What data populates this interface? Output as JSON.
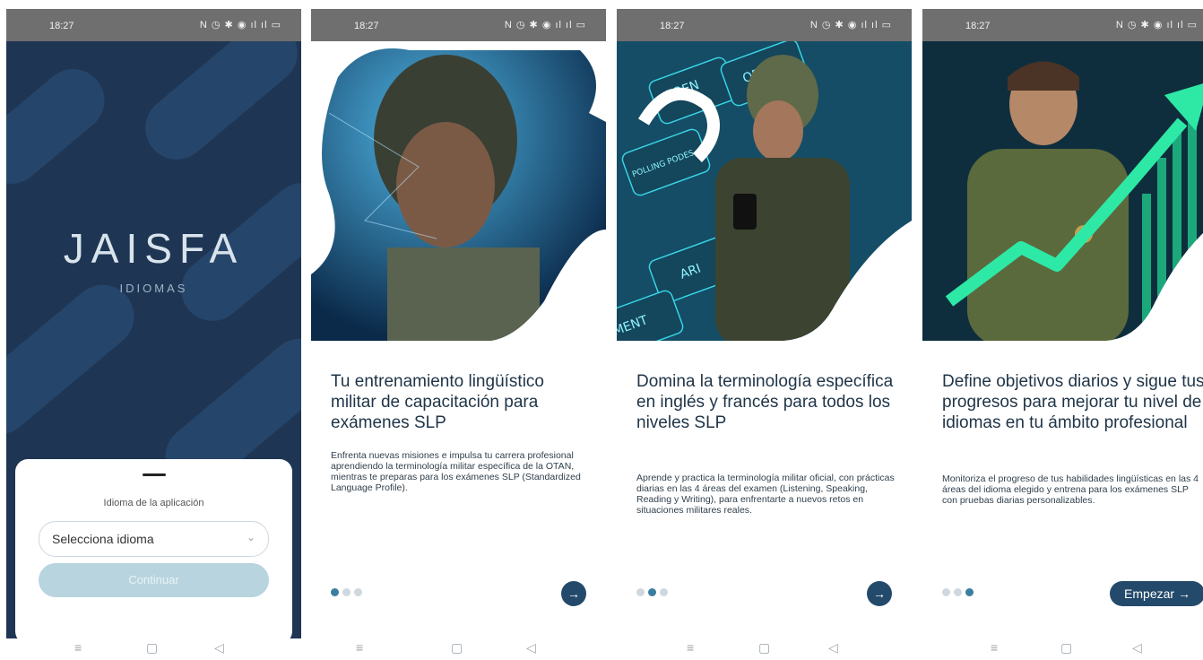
{
  "status": {
    "time": "18:27",
    "icons": "N ◷ ✱ ◉ ıl ıl ▭"
  },
  "nav": {
    "menu": "≡",
    "home": "▢",
    "back": "◁"
  },
  "splash": {
    "logo": "JAISFA",
    "subtitle": "IDIOMAS",
    "language_label": "Idioma de la aplicación",
    "select_placeholder": "Selecciona idioma",
    "continue_label": "Continuar"
  },
  "slides": [
    {
      "title": "Tu entrenamiento lingüístico militar de capacitación para exámenes SLP",
      "description": "Enfrenta nuevas misiones e impulsa tu carrera profesional aprendiendo la terminología militar específica de la OTAN, mientras te preparas para los exámenes SLP (Standardized Language Profile).",
      "action": "→"
    },
    {
      "title": "Domina la terminología específica en inglés y francés para todos los niveles SLP",
      "description": "Aprende y practica la terminología militar oficial, con prácticas diarias en las 4 áreas del examen (Listening, Speaking, Reading y Writing), para enfrentarte a nuevos retos en situaciones militares reales.",
      "action": "→",
      "keycaps": [
        "FOEN",
        "ORIE",
        "POLLING PODES",
        "ARI",
        "MENT"
      ]
    },
    {
      "title": "Define objetivos diarios y sigue tus progresos para mejorar tu nivel de idiomas en tu ámbito profesional",
      "description": "Monitoriza el progreso de tus habilidades lingüísticas en las 4 áreas del idioma elegido y entrena para los exámenes SLP con pruebas diarias personalizables.",
      "action": "Empezar →"
    }
  ],
  "colors": {
    "splash_bg": "#1e3654",
    "primary": "#244a6b",
    "active_dot": "#3a7ea0",
    "button_disabled": "#b8d4de",
    "accent_green": "#2ee8a6"
  }
}
